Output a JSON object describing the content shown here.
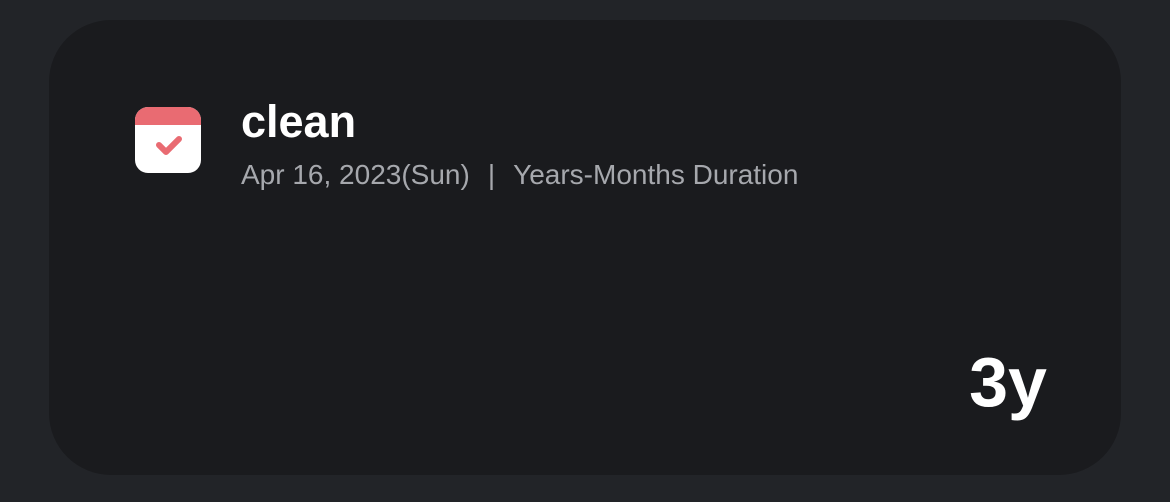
{
  "widget": {
    "icon": "calendar-check-icon",
    "title": "clean",
    "date": "Apr 16, 2023(Sun)",
    "separator": "|",
    "mode": "Years-Months Duration",
    "value": "3y"
  },
  "colors": {
    "background": "#222428",
    "card": "#1a1b1e",
    "accent": "#e96b72",
    "title": "#ffffff",
    "subtitle": "#a6a8ad"
  }
}
